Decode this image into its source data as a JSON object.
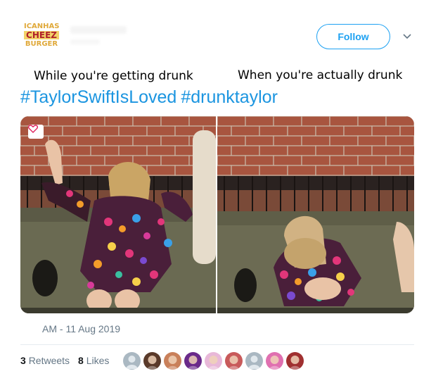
{
  "header": {
    "logo_lines": [
      "ICANHAS",
      "CHEEZ",
      "BURGER"
    ],
    "follow_label": "Follow",
    "chevron_icon": "chevron-down-icon"
  },
  "tweet": {
    "caption_left": "While you're getting drunk",
    "caption_right": "When you're actually drunk",
    "hashtags": [
      "#TaylorSwiftIsLoved",
      "#drunktaylor"
    ],
    "timestamp": "AM - 11 Aug 2019"
  },
  "stats": {
    "retweets_count": "3",
    "retweets_label": "Retweets",
    "likes_count": "8",
    "likes_label": "Likes"
  },
  "colors": {
    "accent": "#1da1f2",
    "hashtag": "#1b95e0",
    "muted": "#657786",
    "like_badge": "#e0245e"
  },
  "avatars": [
    {
      "icon": "default-avatar-icon",
      "color": "#aab8c2"
    },
    {
      "icon": "user-avatar-icon",
      "color": "#5a3a2a"
    },
    {
      "icon": "user-avatar-icon",
      "color": "#c9805a"
    },
    {
      "icon": "user-avatar-icon",
      "color": "#6a2a8a"
    },
    {
      "icon": "user-avatar-icon",
      "color": "#e8b8d8"
    },
    {
      "icon": "user-avatar-icon",
      "color": "#c85a5a"
    },
    {
      "icon": "default-avatar-icon",
      "color": "#aab8c2"
    },
    {
      "icon": "user-avatar-icon",
      "color": "#e070b0"
    },
    {
      "icon": "user-avatar-icon",
      "color": "#a03030"
    }
  ]
}
